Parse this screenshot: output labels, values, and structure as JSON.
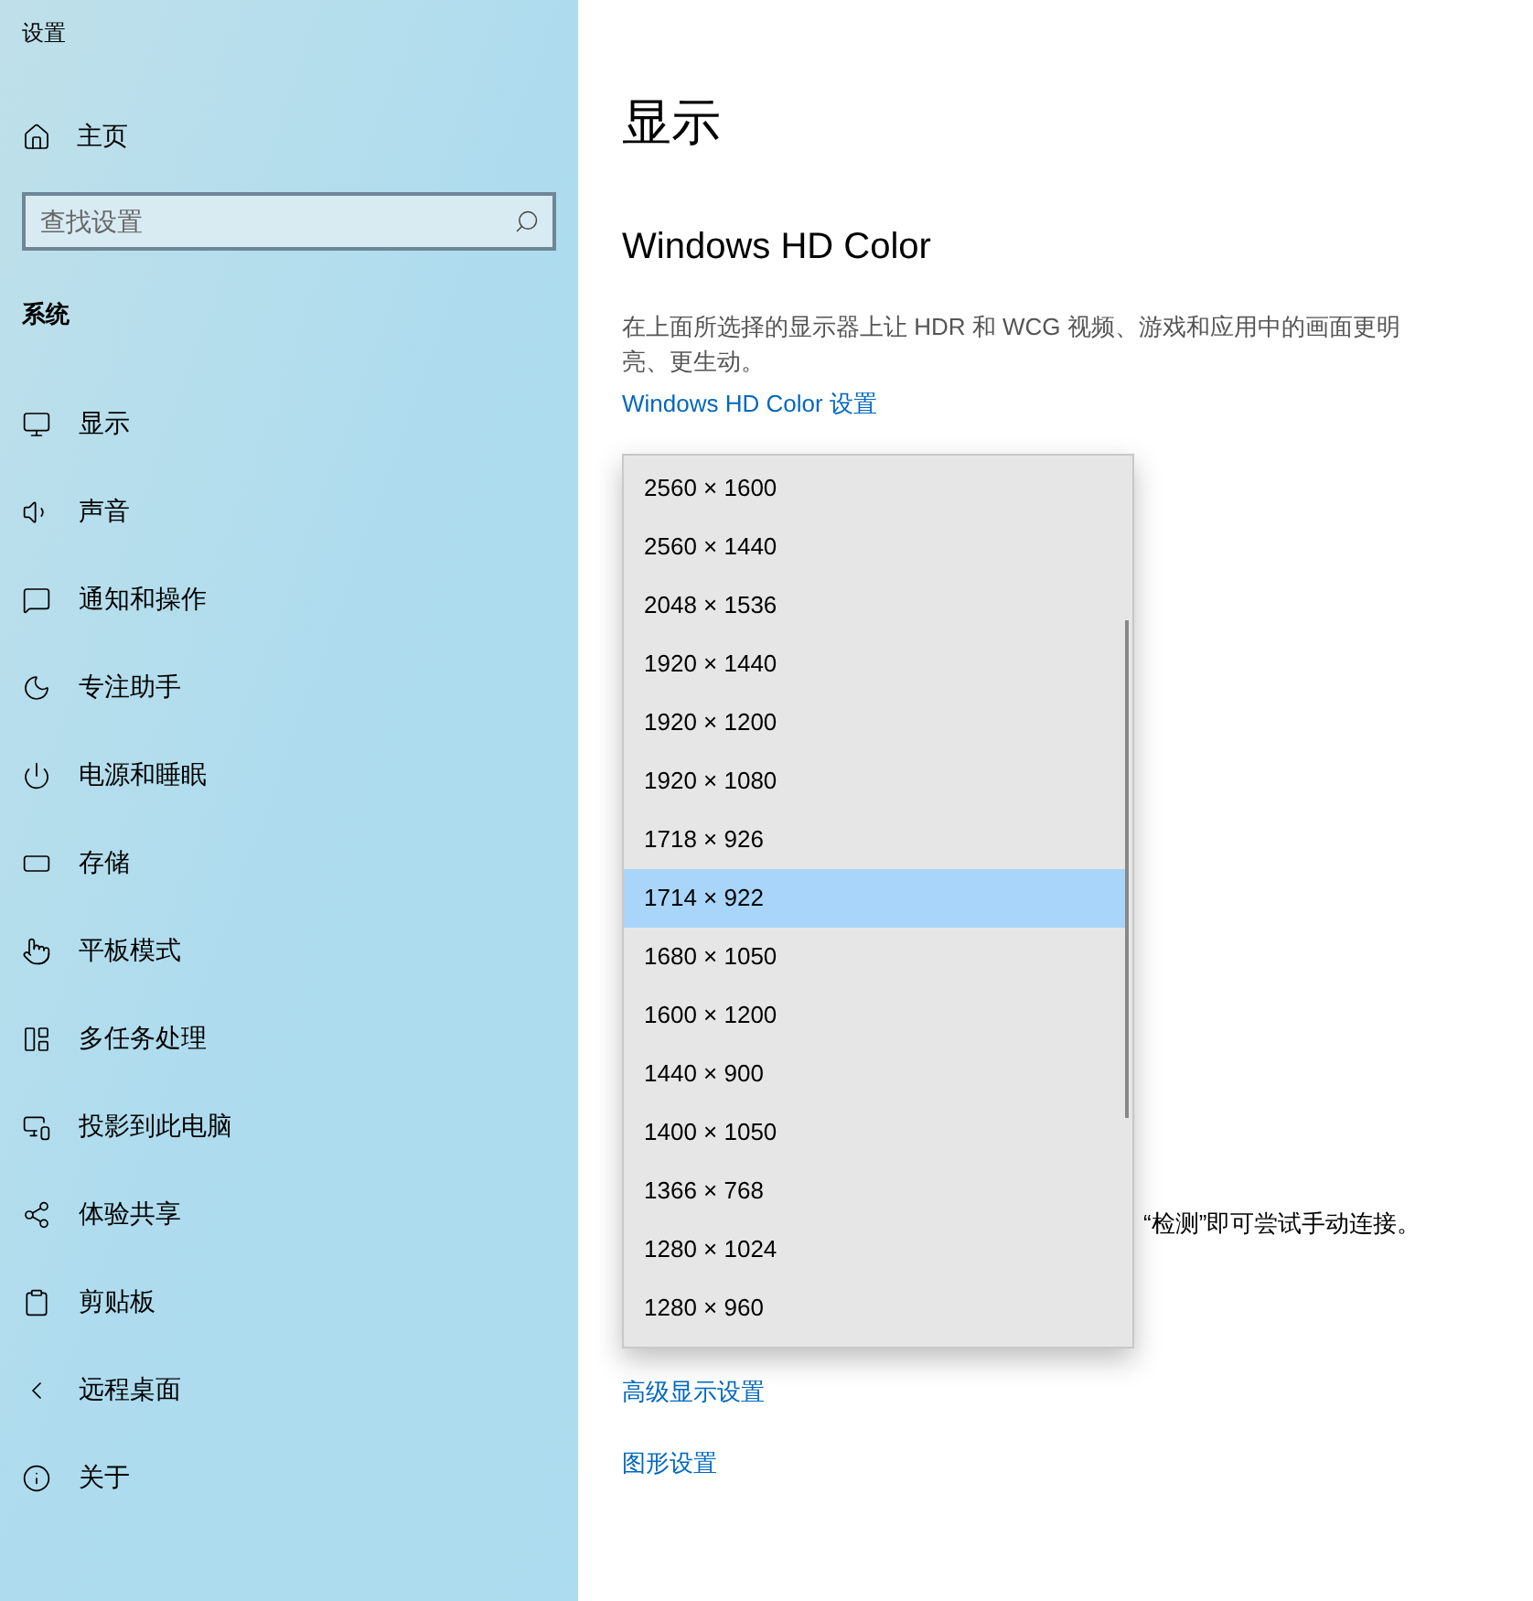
{
  "window": {
    "title": "设置"
  },
  "sidebar": {
    "home": "主页",
    "search": {
      "placeholder": "查找设置"
    },
    "section": "系统",
    "items": [
      {
        "label": "显示"
      },
      {
        "label": "声音"
      },
      {
        "label": "通知和操作"
      },
      {
        "label": "专注助手"
      },
      {
        "label": "电源和睡眠"
      },
      {
        "label": "存储"
      },
      {
        "label": "平板模式"
      },
      {
        "label": "多任务处理"
      },
      {
        "label": "投影到此电脑"
      },
      {
        "label": "体验共享"
      },
      {
        "label": "剪贴板"
      },
      {
        "label": "远程桌面"
      },
      {
        "label": "关于"
      }
    ]
  },
  "main": {
    "title": "显示",
    "section_title": "Windows HD Color",
    "description": "在上面所选择的显示器上让 HDR 和 WCG 视频、游戏和应用中的画面更明亮、更生动。",
    "hd_color_link": "Windows HD Color 设置",
    "partial_text": "“检测”即可尝试手动连接。",
    "links": [
      "高级显示设置",
      "图形设置"
    ]
  },
  "resolution_dropdown": {
    "options": [
      {
        "label": "2560 × 1600",
        "selected": false
      },
      {
        "label": "2560 × 1440",
        "selected": false
      },
      {
        "label": "2048 × 1536",
        "selected": false
      },
      {
        "label": "1920 × 1440",
        "selected": false
      },
      {
        "label": "1920 × 1200",
        "selected": false
      },
      {
        "label": "1920 × 1080",
        "selected": false
      },
      {
        "label": "1718 × 926",
        "selected": false
      },
      {
        "label": "1714 × 922",
        "selected": true
      },
      {
        "label": "1680 × 1050",
        "selected": false
      },
      {
        "label": "1600 × 1200",
        "selected": false
      },
      {
        "label": "1440 × 900",
        "selected": false
      },
      {
        "label": "1400 × 1050",
        "selected": false
      },
      {
        "label": "1366 × 768",
        "selected": false
      },
      {
        "label": "1280 × 1024",
        "selected": false
      },
      {
        "label": "1280 × 960",
        "selected": false
      }
    ]
  }
}
